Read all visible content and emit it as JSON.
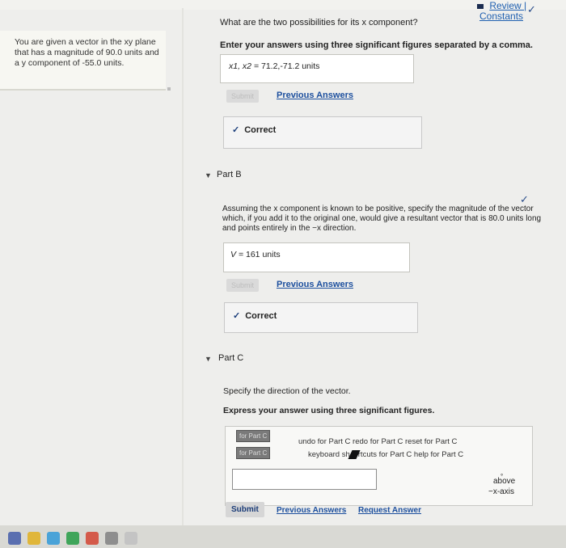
{
  "header": {
    "review_label": "Review |",
    "constants_label": "Constants"
  },
  "intro": {
    "text": "You are given a vector in the xy plane that has a magnitude of 90.0 units and a y component of -55.0 units."
  },
  "part_a": {
    "question": "What are the two possibilities for its x component?",
    "instruction": "Enter your answers using three significant figures separated by a comma.",
    "answer_prefix": "x1, x2 =",
    "answer_value": "71.2,-71.2",
    "answer_unit": "units",
    "submit_label": "Submit",
    "previous_answers_label": "Previous Answers",
    "feedback": "Correct"
  },
  "part_b": {
    "label": "Part B",
    "question": "Assuming the x component is known to be positive, specify the magnitude of the vector which, if you add it to the original one, would give a resultant vector that is 80.0 units long and points entirely in the −x direction.",
    "answer_prefix": "V =",
    "answer_value": "161",
    "answer_unit": "units",
    "submit_label": "Submit",
    "previous_answers_label": "Previous Answers",
    "feedback": "Correct"
  },
  "part_c": {
    "label": "Part C",
    "question": "Specify the direction of the vector.",
    "instruction": "Express your answer using three significant figures.",
    "tag1": "for Part C",
    "tag2": "for Part C",
    "toolbar_line1": "undo for Part C redo for Part C reset for Part C",
    "toolbar_line2a": "keyboard sh",
    "toolbar_line2b": "rtcuts for Part C help for Part C",
    "unit_degree": "°",
    "unit_line1": "above",
    "unit_line2": "−x-axis",
    "submit_label": "Submit",
    "previous_answers_label": "Previous Answers",
    "request_answer_label": "Request Answer"
  },
  "colors": {
    "link": "#1c4f9e",
    "background": "#eeeeec"
  }
}
